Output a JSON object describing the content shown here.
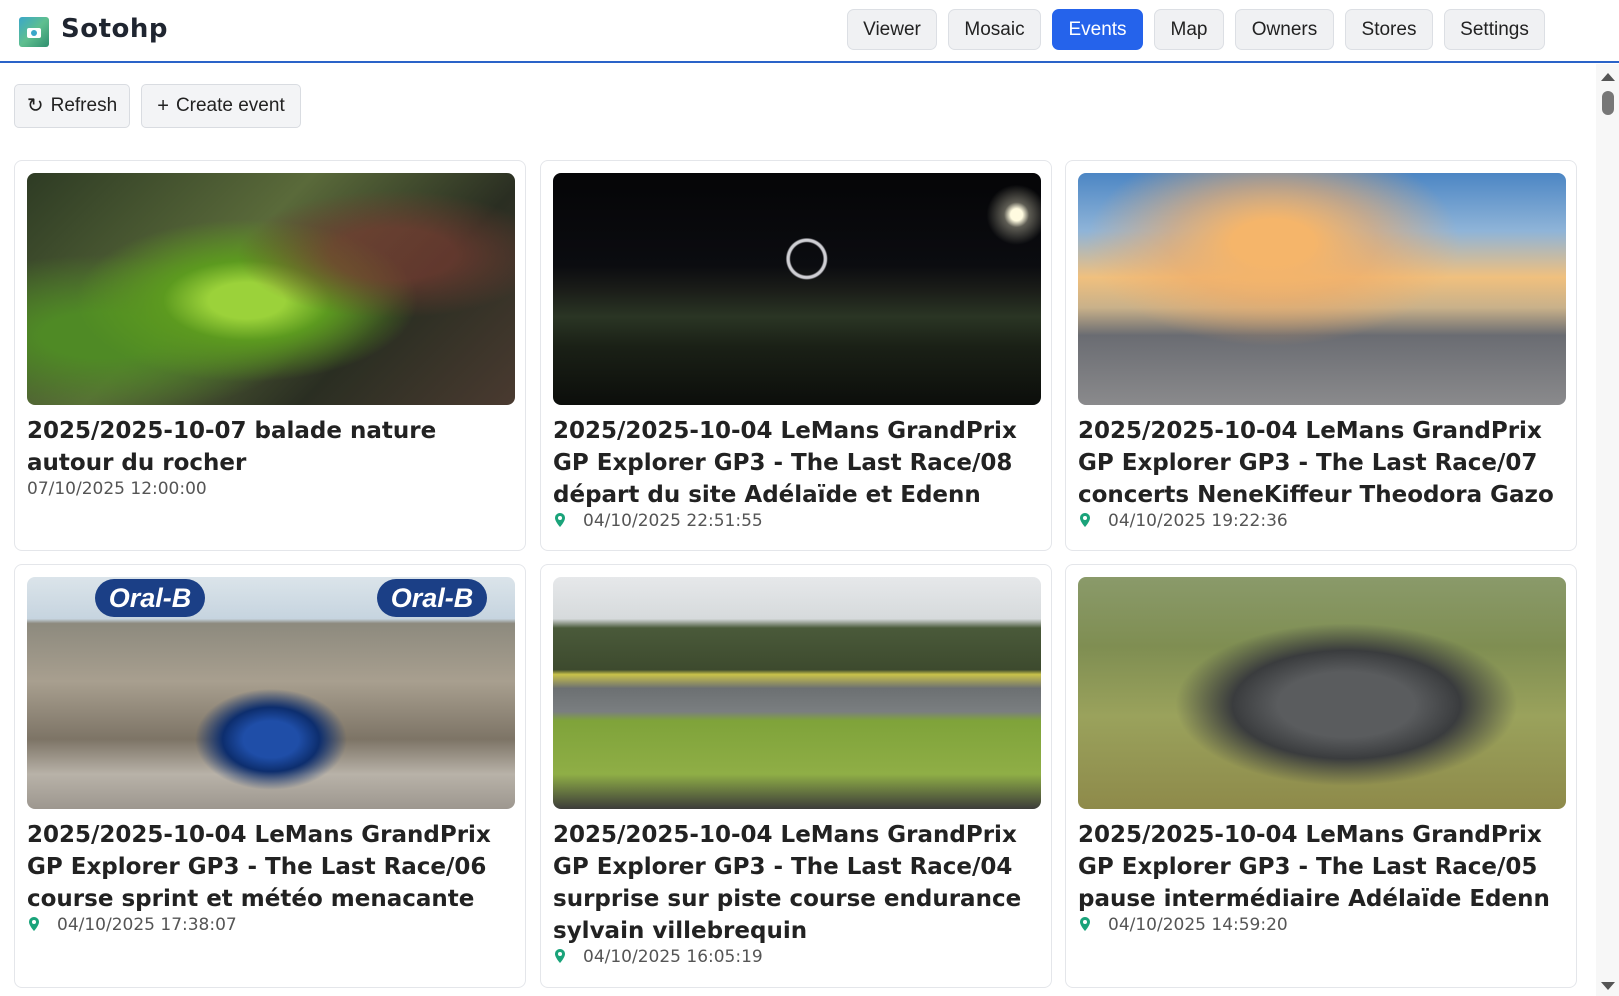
{
  "app": {
    "brand": "Sotohp",
    "logo_icon": "camera-icon"
  },
  "nav": {
    "items": [
      {
        "label": "Viewer",
        "active": false
      },
      {
        "label": "Mosaic",
        "active": false
      },
      {
        "label": "Events",
        "active": true
      },
      {
        "label": "Map",
        "active": false
      },
      {
        "label": "Owners",
        "active": false
      },
      {
        "label": "Stores",
        "active": false
      },
      {
        "label": "Settings",
        "active": false
      }
    ],
    "active_color": "#2563eb"
  },
  "toolbar": {
    "refresh_icon": "↻",
    "refresh_label": "Refresh",
    "create_icon": "+",
    "create_label": "Create event"
  },
  "events": [
    {
      "title": "2025/2025-10-07 balade nature autour du rocher",
      "date": "07/10/2025 12:00:00",
      "has_location": false,
      "image": "fern-photo"
    },
    {
      "title": "2025/2025-10-04 LeMans GrandPrix GP Explorer GP3 - The Last Race/08 départ du site Adélaïde et Edenn",
      "date": "04/10/2025 22:51:55",
      "has_location": true,
      "image": "night-circuit-photo"
    },
    {
      "title": "2025/2025-10-04 LeMans GrandPrix GP Explorer GP3 - The Last Race/07 concerts NeneKiffeur Theodora Gazo",
      "date": "04/10/2025 19:22:36",
      "has_location": true,
      "image": "sunset-paddock-photo"
    },
    {
      "title": "2025/2025-10-04 LeMans GrandPrix GP Explorer GP3 - The Last Race/06 course sprint et météo menacante",
      "date": "04/10/2025 17:38:07",
      "has_location": true,
      "image": "formula-car-photo",
      "sponsor_text": "Oral-B"
    },
    {
      "title": "2025/2025-10-04 LeMans GrandPrix GP Explorer GP3 - The Last Race/04 surprise sur piste course endurance sylvain villebrequin",
      "date": "04/10/2025 16:05:19",
      "has_location": true,
      "image": "endurance-track-photo"
    },
    {
      "title": "2025/2025-10-04 LeMans GrandPrix GP Explorer GP3 - The Last Race/05 pause intermédiaire Adélaïde Edenn",
      "date": "04/10/2025 14:59:20",
      "has_location": true,
      "image": "mustang-photo"
    }
  ],
  "colors": {
    "pin": "#1aa37a",
    "header_border": "#2a63c8"
  }
}
